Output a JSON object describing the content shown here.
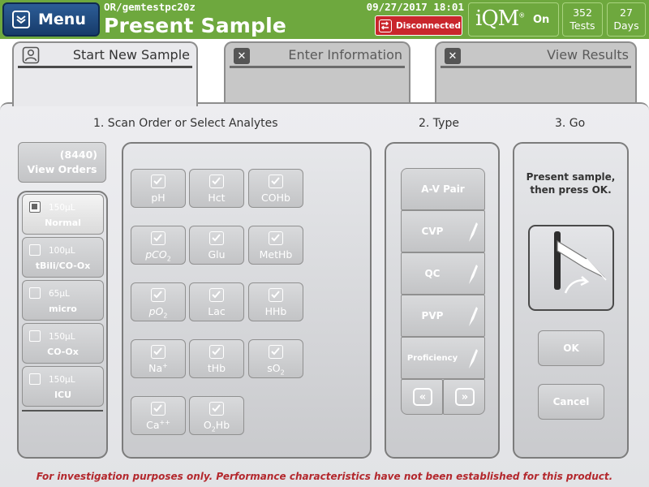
{
  "header": {
    "menu_label": "Menu",
    "device_name": "OR/gemtestpc20z",
    "datetime": "09/27/2017 18:01",
    "page_title": "Present Sample",
    "connection_status": "Disconnected",
    "iqm_logo": "iQM",
    "iqm_reg": "®",
    "iqm_status": "On",
    "tests_count": "352",
    "tests_label": "Tests",
    "days_count": "27",
    "days_label": "Days",
    "colors": {
      "header_bg": "#6ea83e",
      "menu_bg": "#1f4a80",
      "disconnected_bg": "#c9262c"
    }
  },
  "tabs": [
    {
      "label": "Start New Sample",
      "icon": "sample-person-icon",
      "active": true
    },
    {
      "label": "Enter Information",
      "icon": "close-icon",
      "active": false
    },
    {
      "label": "View Results",
      "icon": "close-icon",
      "active": false
    }
  ],
  "sections": {
    "scan": "1. Scan Order or Select Analytes",
    "type": "2. Type",
    "go": "3. Go"
  },
  "view_orders": {
    "count": "(8440)",
    "label": "View Orders"
  },
  "sample_types": [
    {
      "volume": "150µL",
      "name": "Normal",
      "selected": true
    },
    {
      "volume": "100µL",
      "name": "tBili/CO-Ox",
      "selected": false
    },
    {
      "volume": "65µL",
      "name": "micro",
      "selected": false
    },
    {
      "volume": "150µL",
      "name": "CO-Ox",
      "selected": false
    },
    {
      "volume": "150µL",
      "name": "ICU",
      "selected": false
    }
  ],
  "analytes": [
    {
      "name": "pH",
      "checked": true
    },
    {
      "name": "Hct",
      "checked": true
    },
    {
      "name": "COHb",
      "checked": true
    },
    {
      "base": "pCO",
      "sub": "2",
      "checked": true
    },
    {
      "name": "Glu",
      "checked": true
    },
    {
      "name": "MetHb",
      "checked": true
    },
    {
      "base": "pO",
      "sub": "2",
      "checked": true
    },
    {
      "name": "Lac",
      "checked": true
    },
    {
      "name": "HHb",
      "checked": true
    },
    {
      "base": "Na",
      "sup": "+",
      "checked": true
    },
    {
      "name": "tHb",
      "checked": true
    },
    {
      "base": "sO",
      "sub": "2",
      "checked": true
    },
    {
      "base": "Ca",
      "sup": "++",
      "checked": true
    },
    {
      "base": "O",
      "sub": "2",
      "tail": "Hb",
      "checked": true
    }
  ],
  "sample_type_options": [
    {
      "label": "A-V Pair",
      "icon": ""
    },
    {
      "label": "CVP",
      "icon": "syringe-icon"
    },
    {
      "label": "QC",
      "icon": "syringe-icon"
    },
    {
      "label": "PVP",
      "icon": "syringe-icon"
    },
    {
      "label": "Proficiency",
      "icon": "syringe-icon"
    }
  ],
  "paging": {
    "prev": "«",
    "next": "»"
  },
  "go": {
    "instruction_line1": "Present sample,",
    "instruction_line2": "then press OK.",
    "ok_label": "OK",
    "cancel_label": "Cancel"
  },
  "disclaimer": "For investigation purposes only.  Performance characteristics have not been established for this product."
}
